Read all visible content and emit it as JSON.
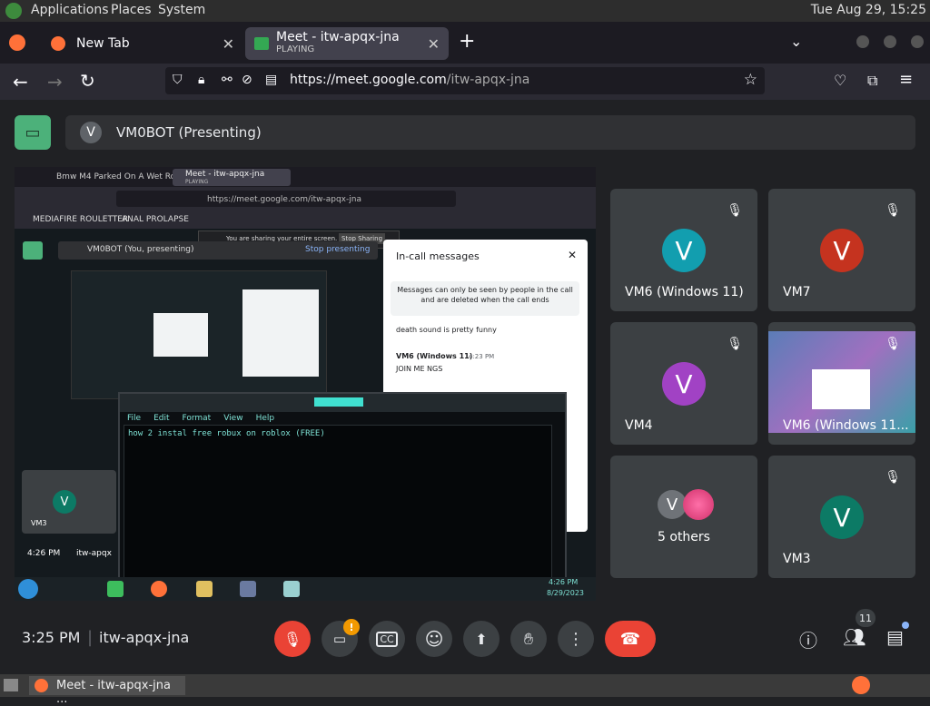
{
  "system_panel": {
    "menus": [
      "Applications",
      "Places",
      "System"
    ],
    "clock": "Tue Aug 29, 15:25"
  },
  "browser": {
    "tabs": [
      {
        "title": "New Tab"
      },
      {
        "title": "Meet - itw-apqx-jna",
        "subtitle": "PLAYING"
      }
    ],
    "url_host": "https://meet.google.com",
    "url_path": "/itw-apqx-jna"
  },
  "meet": {
    "presenting_bar": {
      "avatar": "V",
      "label": "VM0BOT (Presenting)"
    },
    "tiles": [
      {
        "initial": "V",
        "name": "VM6 (Windows 11)",
        "color": "#129eaf"
      },
      {
        "initial": "V",
        "name": "VM7",
        "color": "#c5331f"
      },
      {
        "initial": "V",
        "name": "VM4",
        "color": "#a142c4"
      },
      {
        "initial": "",
        "name": "VM6 (Windows 11...",
        "color": "#3c4043"
      },
      {
        "initial": "V",
        "name": "5 others",
        "color": "#6f7378"
      },
      {
        "initial": "V",
        "name": "VM3",
        "color": "#0c7a65"
      }
    ],
    "bottom": {
      "time": "3:25 PM",
      "meeting_code": "itw-apqx-jna",
      "people_count": "11",
      "camera_alert": "!"
    }
  },
  "shared_screen": {
    "tab1": "Bmw M4 Parked On A Wet Ro",
    "tab2": "Meet - itw-apqx-jna",
    "tab2_sub": "PLAYING",
    "url": "https://meet.google.com/itw-apqx-jna",
    "bookmark1": "MEDIAFIRE ROULETTER",
    "bookmark2": "ANAL PROLAPSE",
    "sharing_notice": "You are sharing your entire screen.",
    "stop_sharing": "Stop Sharing",
    "presenting_label": "VM0BOT (You, presenting)",
    "stop_presenting": "Stop presenting",
    "chat_title": "In-call messages",
    "chat_notice": "Messages can only be seen by people in the call and are deleted when the call ends",
    "chat_msg1": "death sound is pretty funny",
    "chat_sender": "VM6 (Windows 11)",
    "chat_time": "4:23 PM",
    "chat_msg2": "JOIN ME NGS",
    "editor_menu": [
      "File",
      "Edit",
      "Format",
      "View",
      "Help"
    ],
    "editor_text": "how 2 instal free robux on roblox (FREE)",
    "small_tile_name": "VM3",
    "small_time": "4:26 PM",
    "small_code": "itw-apqx",
    "taskbar_time": "4:26 PM",
    "taskbar_date": "8/29/2023"
  },
  "taskbar": {
    "window_title": "Meet - itw-apqx-jna ..."
  }
}
